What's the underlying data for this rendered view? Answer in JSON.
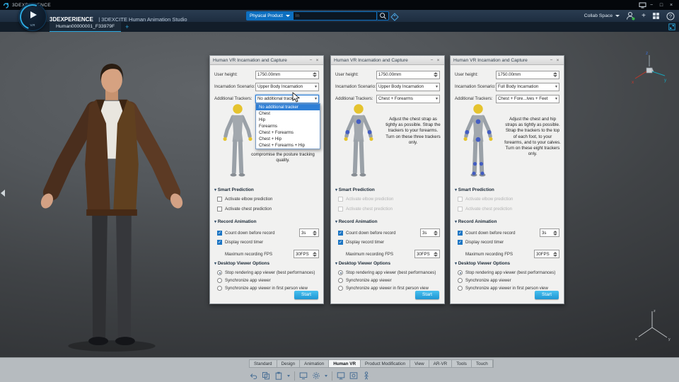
{
  "titlebar": {
    "app": "3DEXPERIENCE",
    "minimize": "−",
    "maximize": "□",
    "close": "×"
  },
  "header": {
    "brand_bold": "3DEXPERIENCE",
    "brand_rest": "| 3DEXCITE Human Animation Studio",
    "play_badge": "V.R",
    "search_scope": "Physical Product",
    "search_placeholder": "In",
    "collab_label": "Collab Space",
    "add_label": "+"
  },
  "tabbar": {
    "active_tab": "Human00000001_F33979F",
    "add_tab": "+"
  },
  "panel_labels": {
    "title": "Human VR Incarnation and Capture",
    "minimize": "−",
    "close": "×",
    "user_height": "User height:",
    "scenario": "Incarnation Scenario:",
    "trackers": "Additional Trackers:",
    "smart_prediction": "Smart Prediction",
    "elbow_prediction": "Activate elbow prediction",
    "chest_prediction": "Activate chest prediction",
    "record_animation": "Record Animation",
    "countdown": "Count down before record",
    "countdown_value": "3s",
    "display_timer": "Display record timer",
    "max_fps": "Maximum recording FPS",
    "fps_value": "30FPS",
    "viewer_options": "Desktop Viewer Options",
    "stop_rendering": "Stop rendering app viewer (best performances)",
    "sync_viewer": "Synchronize app viewer",
    "sync_first_person": "Synchronize app viewer in first person view",
    "start": "Start"
  },
  "panels": [
    {
      "user_height": "1750.00mm",
      "scenario": "Upper Body Incarnation",
      "trackers": "No additional tracker",
      "description": "compromise the posture tracking quality."
    },
    {
      "user_height": "1750.00mm",
      "scenario": "Upper Body Incarnation",
      "trackers": "Chest + Forearms",
      "description": "Adjust the chest strap as tightly as possible. Strap the trackers to your forearms. Turn on these three trackers only."
    },
    {
      "user_height": "1750.00mm",
      "scenario": "Full Body Incarnation",
      "trackers": "Chest + Fore...lves + Feet",
      "description": "Adjust the chest and hip straps as tightly as possible. Strap the trackers to the top of each foot, to your forearms, and to your calves. Turn on these eight trackers only."
    }
  ],
  "tracker_dropdown": {
    "options": [
      "No additional tracker",
      "Chest",
      "Hip",
      "Forearms",
      "Chest + Forearms",
      "Chest + Hip",
      "Chest + Forearms + Hip"
    ]
  },
  "bottom_toolbar": {
    "tabs": [
      "Standard",
      "Design",
      "Animation",
      "Human VR",
      "Product Modification",
      "View",
      "AR-VR",
      "Tools",
      "Touch"
    ],
    "active_tab": "Human VR"
  },
  "compass": {
    "x": "x",
    "y": "y",
    "z": "z"
  },
  "icons": {
    "titlebar": [
      "logo-icon",
      "display-icon",
      "minimize-icon",
      "maximize-icon",
      "close-icon"
    ],
    "header": [
      "compass-play-icon",
      "search-icon",
      "tag-icon",
      "user-icon",
      "add-icon",
      "grid-icon",
      "help-icon"
    ],
    "toolbar": [
      "undo-icon",
      "copy-icon",
      "paste-icon",
      "screen-icon",
      "gear-icon",
      "monitor-icon",
      "capture-icon",
      "human-icon"
    ]
  },
  "colors": {
    "accent_blue": "#2ba9e0",
    "selection_blue": "#2f7fd6",
    "tracker_blue": "#3a55c4",
    "mannequin_yellow": "#e5c32e"
  }
}
